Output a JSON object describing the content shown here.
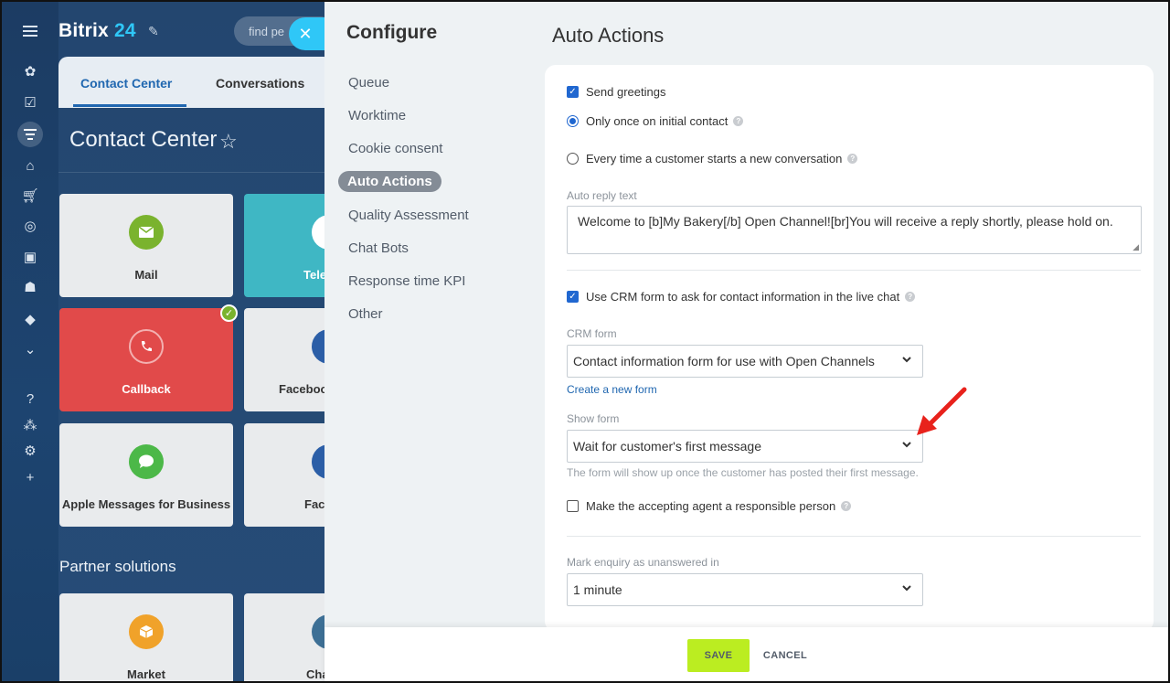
{
  "app": {
    "brand_name": "Bitrix",
    "brand_number": "24",
    "search_placeholder": "find pe",
    "tabs": [
      {
        "label": "Contact Center"
      },
      {
        "label": "Conversations"
      }
    ],
    "section_title": "Contact Center",
    "tiles": [
      {
        "label": "Mail",
        "icon": "mail-icon",
        "color": "#7ab32e"
      },
      {
        "label": "Tele",
        "icon": "phone-icon",
        "color": "#3d6f95"
      },
      {
        "label": "Callback",
        "icon": "callback-icon",
        "color": "#d9d9d9"
      },
      {
        "label": "Faceboo",
        "icon": "facebook-icon",
        "color": "#2b5ea7"
      },
      {
        "label": "Apple Messages for Business",
        "icon": "chat-bubble-icon",
        "color": "#4cb848"
      },
      {
        "label": "Fac",
        "icon": "facebook-icon",
        "color": "#2b5ea7"
      },
      {
        "label": "Market",
        "icon": "box-icon",
        "color": "#f0a22a"
      },
      {
        "label": "Cha",
        "icon": "chat-icon",
        "color": "#3d6f95"
      }
    ],
    "partner_title": "Partner solutions"
  },
  "configure": {
    "title": "Configure",
    "nav": [
      {
        "label": "Queue"
      },
      {
        "label": "Worktime"
      },
      {
        "label": "Cookie consent"
      },
      {
        "label": "Auto Actions",
        "active": true
      },
      {
        "label": "Quality Assessment"
      },
      {
        "label": "Chat Bots"
      },
      {
        "label": "Response time KPI"
      },
      {
        "label": "Other"
      }
    ]
  },
  "auto_actions": {
    "title": "Auto Actions",
    "send_greetings": {
      "label": "Send greetings",
      "checked": true
    },
    "radio_once": {
      "label": "Only once on initial contact",
      "selected": true
    },
    "radio_every": {
      "label": "Every time a customer starts a new conversation",
      "selected": false
    },
    "auto_reply_label": "Auto reply text",
    "auto_reply_value": "Welcome to [b]My Bakery[/b] Open Channel![br]You will receive a reply shortly, please hold on.",
    "use_crm_form": {
      "label": "Use CRM form to ask for contact information in the live chat",
      "checked": true
    },
    "crm_form_label": "CRM form",
    "crm_form_value": "Contact information form for use with Open Channels",
    "create_form_link": "Create a new form",
    "show_form_label": "Show form",
    "show_form_value": "Wait for customer's first message",
    "show_form_hint": "The form will show up once the customer has posted their first message.",
    "responsible": {
      "label": "Make the accepting agent a responsible person",
      "checked": false
    },
    "unanswered_label": "Mark enquiry as unanswered in",
    "unanswered_value": "1 minute"
  },
  "footer": {
    "save_label": "SAVE",
    "cancel_label": "CANCEL"
  },
  "colors": {
    "accent": "#2067b0",
    "save": "#bbed21",
    "annotation_arrow": "#e8221c"
  }
}
